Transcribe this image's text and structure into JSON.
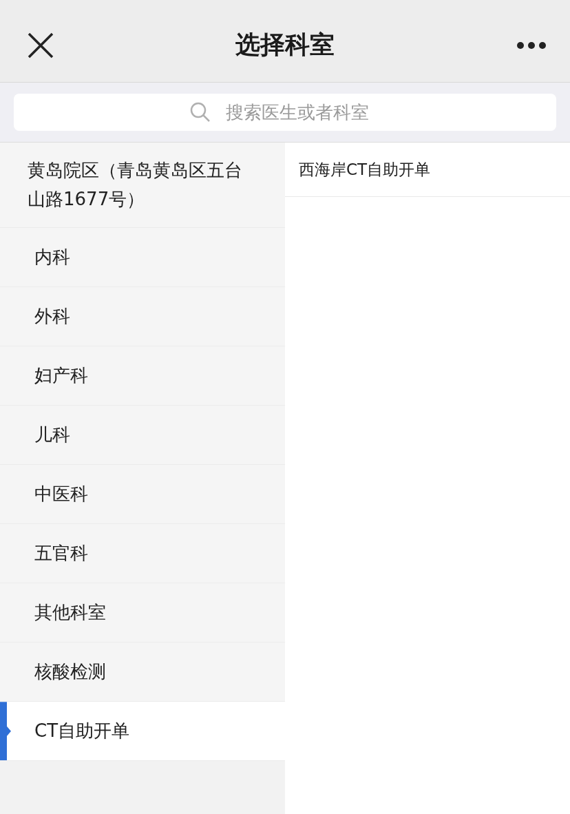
{
  "header": {
    "title": "选择科室"
  },
  "search": {
    "placeholder": "搜索医生或者科室"
  },
  "departments": [
    {
      "label": "黄岛院区（青岛黄岛区五台山路1677号）",
      "selected": false
    },
    {
      "label": "内科",
      "selected": false
    },
    {
      "label": "外科",
      "selected": false
    },
    {
      "label": "妇产科",
      "selected": false
    },
    {
      "label": "儿科",
      "selected": false
    },
    {
      "label": "中医科",
      "selected": false
    },
    {
      "label": "五官科",
      "selected": false
    },
    {
      "label": "其他科室",
      "selected": false
    },
    {
      "label": "核酸检测",
      "selected": false
    },
    {
      "label": "CT自助开单",
      "selected": true
    }
  ],
  "sub_departments": [
    {
      "label": "西海岸CT自助开单"
    }
  ]
}
